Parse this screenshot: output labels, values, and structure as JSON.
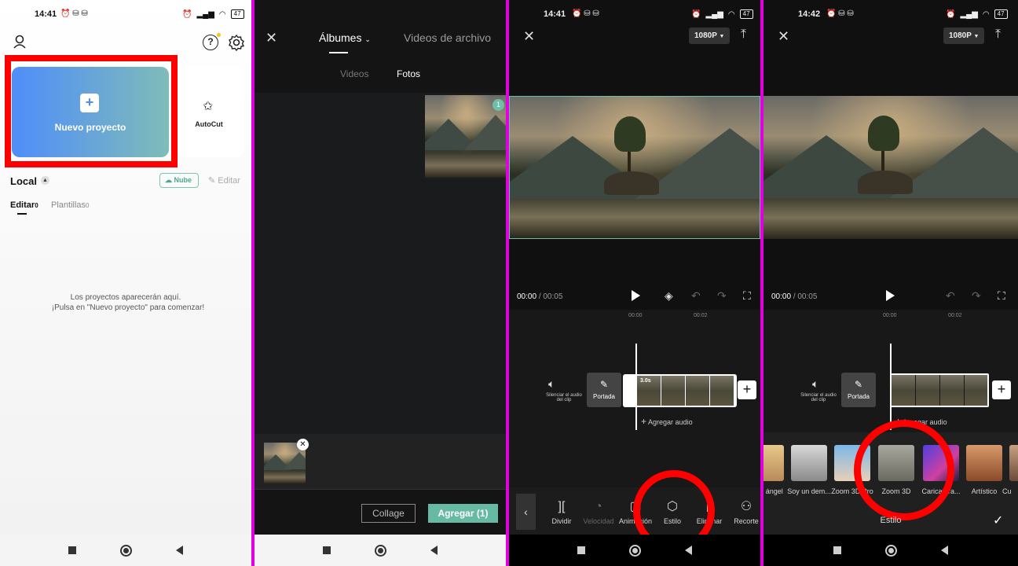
{
  "p1": {
    "time": "14:41",
    "battery": "47",
    "new_project": "Nuevo proyecto",
    "autocut": "AutoCut",
    "local": "Local",
    "cloud": "Nube",
    "edit": "Editar",
    "tab_edit": "Editar",
    "tab_edit_count": "0",
    "tab_templates": "Plantillas",
    "tab_templates_count": "0",
    "empty_line1": "Los proyectos aparecerán aquí.",
    "empty_line2": "¡Pulsa en \"Nuevo proyecto\" para comenzar!"
  },
  "p2": {
    "tab_albums": "Álbumes",
    "tab_stock": "Videos de archivo",
    "sub_videos": "Videos",
    "sub_photos": "Fotos",
    "badge": "1",
    "collage": "Collage",
    "add": "Agregar (1)"
  },
  "p3": {
    "time": "14:41",
    "battery": "47",
    "resolution": "1080P",
    "timecode": "00:00",
    "duration": "00:05",
    "tick_0": "00:00",
    "tick_2": "00:02",
    "mute_label": "Silenciar el audio del clip",
    "cover": "Portada",
    "clip_len": "3.0s",
    "add_audio": "Agregar audio",
    "tools": [
      "Dividir",
      "Velocidad",
      "Animación",
      "Estilo",
      "Eliminar",
      "Recorte"
    ]
  },
  "p4": {
    "time": "14:42",
    "battery": "47",
    "resolution": "1080P",
    "timecode": "00:00",
    "duration": "00:05",
    "tick_0": "00:00",
    "tick_2": "00:02",
    "mute_label": "Silenciar el audio del clip",
    "cover": "Portada",
    "add_audio": "Agregar audio",
    "styles": [
      "n ángel",
      "Soy un dem...",
      "Zoom 3D Pro",
      "Zoom 3D",
      "Caricatura...",
      "Artístico",
      "Cu"
    ],
    "panel_title": "Estilo"
  }
}
